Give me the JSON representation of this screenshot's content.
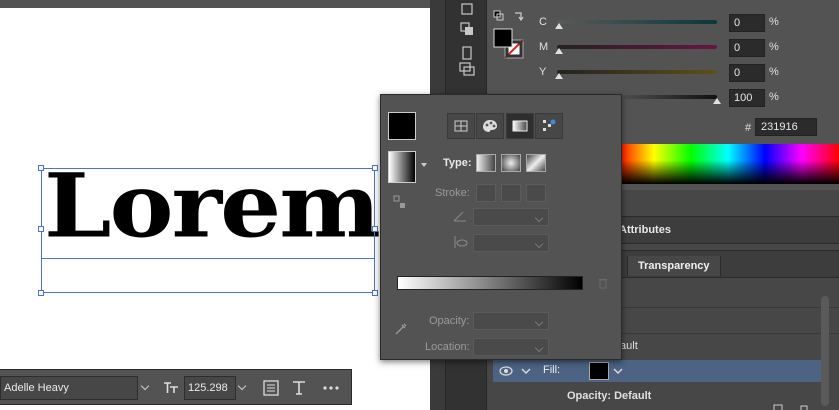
{
  "canvas": {
    "text": "Lorem"
  },
  "color_panel": {
    "channels": [
      {
        "label": "C",
        "value": "0",
        "unit": "%",
        "color": "#1aa0a8"
      },
      {
        "label": "M",
        "value": "0",
        "unit": "%",
        "color": "#c0207a"
      },
      {
        "label": "Y",
        "value": "0",
        "unit": "%",
        "color": "#b8a020"
      },
      {
        "label": "",
        "value": "100",
        "unit": "%",
        "color": "#000000"
      }
    ],
    "hex_label": "#",
    "hex_value": "231916"
  },
  "lower_panel": {
    "tab_attributes": "Attributes",
    "tab_transparency": "Transparency",
    "default_text": "fault",
    "fill_label": "Fill:",
    "opacity_default": "Opacity: Default"
  },
  "gradient_panel": {
    "type_label": "Type:",
    "stroke_label": "Stroke:",
    "opacity_label": "Opacity:",
    "location_label": "Location:"
  },
  "properties_bar": {
    "font_family": "Adelle Heavy",
    "font_size": "125.298"
  },
  "icons": [
    "eye-icon",
    "trash-icon",
    "eyedropper-icon",
    "swap-arrow-icon",
    "fill-stroke-icon",
    "gradient-tab-icon",
    "swatches-tab-icon",
    "color-tab-icon",
    "pattern-tab-icon",
    "text-size-icon",
    "paragraph-icon",
    "type-icon",
    "more-icon"
  ]
}
